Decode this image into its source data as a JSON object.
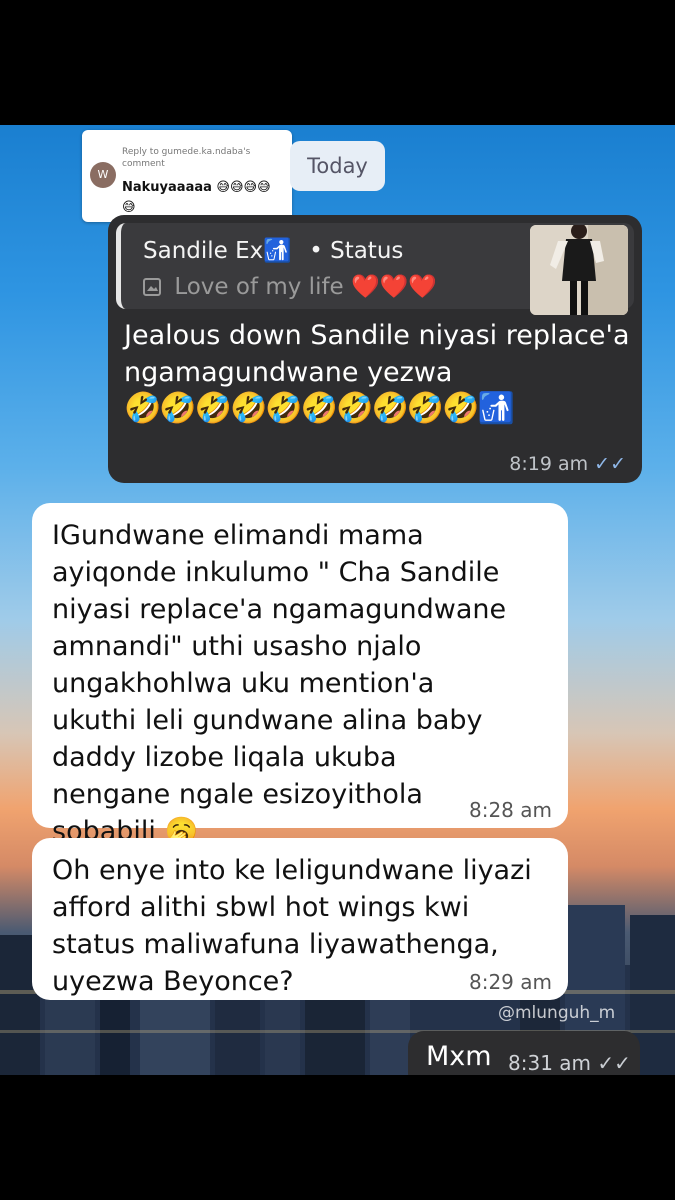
{
  "reply_card": {
    "avatar_letter": "W",
    "header": "Reply to gumede.ka.ndaba's comment",
    "text": "Nakuyaaaaa 😅😅😅😅😅"
  },
  "date_separator": "Today",
  "outgoing_status_reply": {
    "quote_name": "Sandile Ex🚮",
    "quote_source": "• Status",
    "quote_caption": "Love of my life ❤️❤️❤️",
    "message": "Jealous down Sandile niyasi replace'a ngamagundwane yezwa",
    "emojis": "🤣🤣🤣🤣🤣🤣🤣🤣🤣🤣🚮",
    "time": "8:19 am",
    "ticks": "✓✓"
  },
  "incoming_1": {
    "message": "IGundwane elimandi mama ayiqonde inkulumo \" Cha Sandile niyasi replace'a ngamagundwane amnandi\" uthi usasho njalo ungakhohlwa uku mention'a ukuthi leli gundwane alina baby daddy lizobe liqala ukuba nengane ngale esizoyithola sobabili 🥱",
    "time": "8:28 am"
  },
  "incoming_2": {
    "message": "Oh enye into ke leligundwane liyazi afford alithi sbwl hot wings kwi status maliwafuna liyawathenga, uyezwa Beyonce?",
    "time": "8:29 am"
  },
  "watermark": "@mlunguh_m",
  "outgoing_mxm": {
    "message": "Mxm",
    "time": "8:31 am",
    "ticks": "✓✓"
  }
}
